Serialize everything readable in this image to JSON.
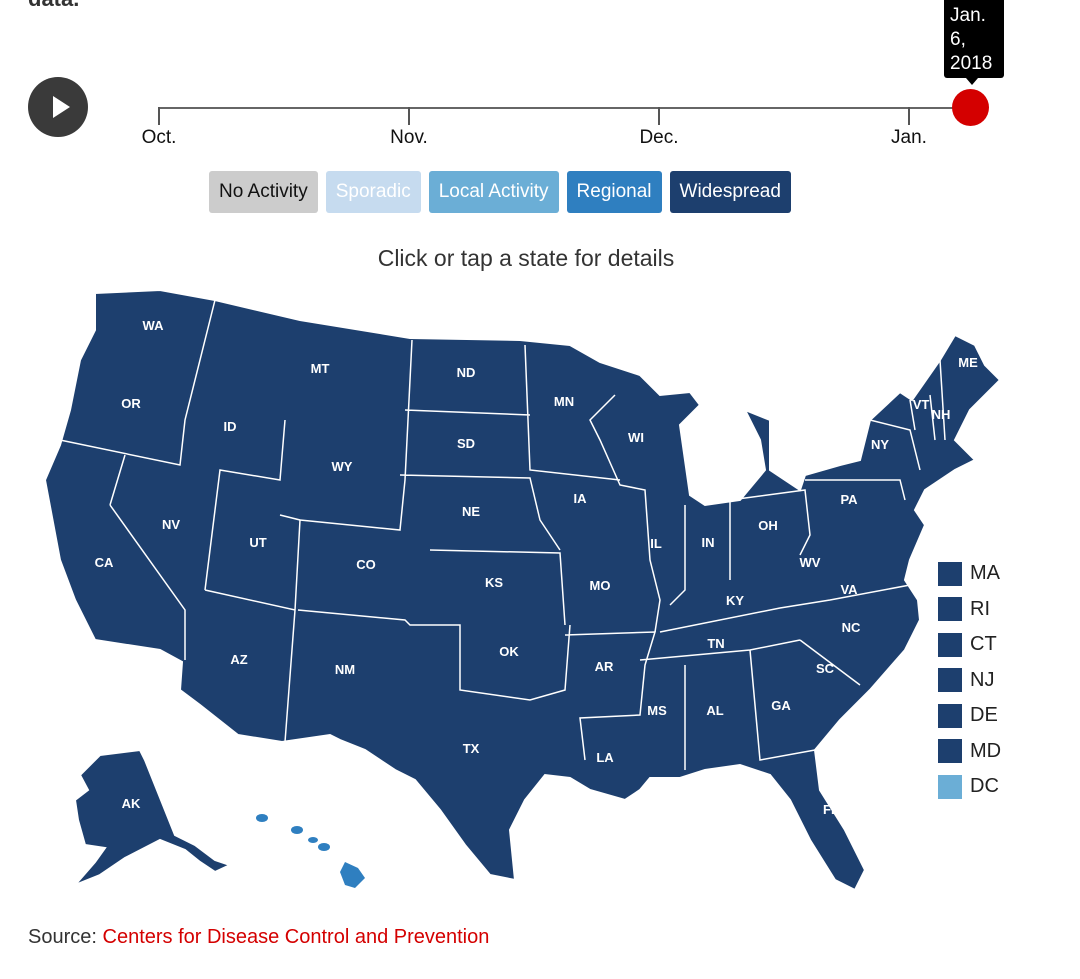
{
  "intro_fragment": "data.",
  "timeline": {
    "months": [
      "Oct.",
      "Nov.",
      "Dec.",
      "Jan."
    ],
    "current_date_lines": [
      "Jan.",
      "6,",
      "2018"
    ],
    "position_fraction": 1.0
  },
  "legend": [
    {
      "label": "No Activity",
      "color": "#cccccc",
      "text": "#111"
    },
    {
      "label": "Sporadic",
      "color": "#c6dbef",
      "text": "#fff"
    },
    {
      "label": "Local Activity",
      "color": "#6baed6",
      "text": "#fff"
    },
    {
      "label": "Regional",
      "color": "#2f7fc0",
      "text": "#fff"
    },
    {
      "label": "Widespread",
      "color": "#1d3f6e",
      "text": "#fff"
    }
  ],
  "hint": "Click or tap a state for details",
  "states": {
    "WA": "Widespread",
    "OR": "Widespread",
    "CA": "Widespread",
    "ID": "Widespread",
    "NV": "Widespread",
    "MT": "Widespread",
    "WY": "Widespread",
    "UT": "Widespread",
    "AZ": "Widespread",
    "CO": "Widespread",
    "NM": "Widespread",
    "ND": "Widespread",
    "SD": "Widespread",
    "NE": "Widespread",
    "KS": "Widespread",
    "OK": "Widespread",
    "TX": "Widespread",
    "MN": "Widespread",
    "IA": "Widespread",
    "MO": "Widespread",
    "AR": "Widespread",
    "LA": "Widespread",
    "WI": "Widespread",
    "IL": "Widespread",
    "MI": "Widespread",
    "IN": "Widespread",
    "OH": "Widespread",
    "KY": "Widespread",
    "TN": "Widespread",
    "MS": "Widespread",
    "AL": "Widespread",
    "GA": "Widespread",
    "FL": "Widespread",
    "SC": "Widespread",
    "NC": "Widespread",
    "VA": "Widespread",
    "WV": "Widespread",
    "PA": "Widespread",
    "NY": "Widespread",
    "VT": "Widespread",
    "NH": "Widespread",
    "ME": "Widespread",
    "AK": "Widespread",
    "HI": "Regional"
  },
  "small_states": [
    {
      "label": "MA",
      "level": "Widespread",
      "color": "#1d3f6e"
    },
    {
      "label": "RI",
      "level": "Widespread",
      "color": "#1d3f6e"
    },
    {
      "label": "CT",
      "level": "Widespread",
      "color": "#1d3f6e"
    },
    {
      "label": "NJ",
      "level": "Widespread",
      "color": "#1d3f6e"
    },
    {
      "label": "DE",
      "level": "Widespread",
      "color": "#1d3f6e"
    },
    {
      "label": "MD",
      "level": "Widespread",
      "color": "#1d3f6e"
    },
    {
      "label": "DC",
      "level": "Local Activity",
      "color": "#6baed6"
    }
  ],
  "source": {
    "prefix": "Source:",
    "link": "Centers for Disease Control and Prevention"
  }
}
